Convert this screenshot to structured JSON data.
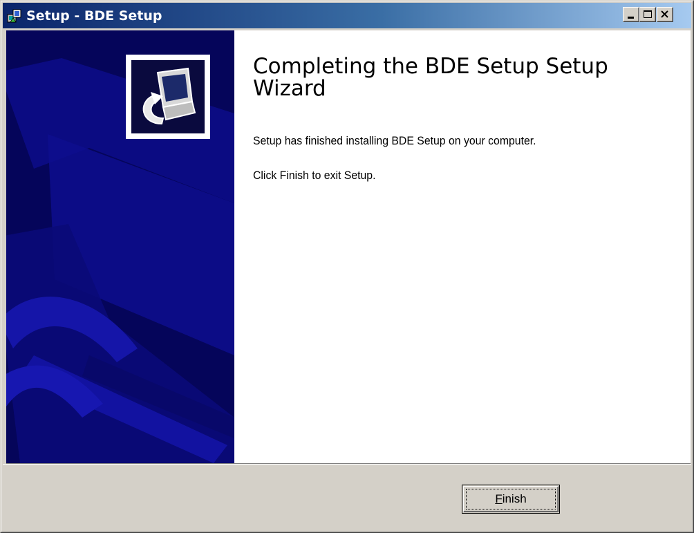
{
  "window": {
    "title": "Setup - BDE Setup",
    "icon": "setup-installer-icon",
    "controls": {
      "minimize_icon": "minimize-icon",
      "maximize_icon": "maximize-icon",
      "close_icon": "close-icon"
    }
  },
  "wizard": {
    "heading": "Completing the BDE Setup Setup Wizard",
    "message": "Setup has finished installing BDE Setup on your computer.",
    "instruction": "Click Finish to exit Setup.",
    "logo_icon": "computer-install-icon"
  },
  "footer": {
    "finish_label": "Finish",
    "finish_access_key": "F",
    "finish_rest": "inish"
  },
  "colors": {
    "titlebar_start": "#0a246a",
    "titlebar_end": "#a6caf0",
    "side_panel": "#05055a",
    "dialog_face": "#d4d0c8"
  }
}
